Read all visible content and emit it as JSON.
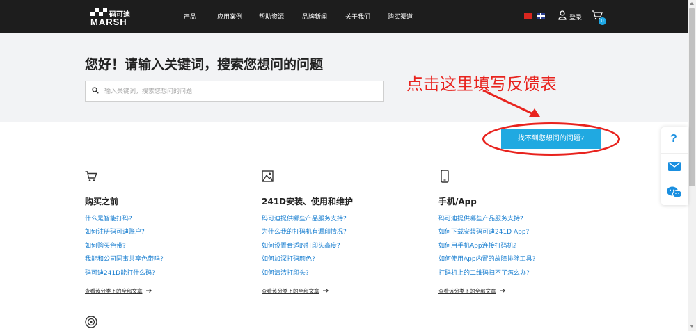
{
  "header": {
    "logo_cn": "码可迪",
    "logo_en": "MARSH",
    "nav": [
      "产品",
      "应用案例",
      "帮助资源",
      "品牌新闻",
      "关于我们",
      "购买渠道"
    ],
    "login_label": "登录",
    "cart_count": "0"
  },
  "hero": {
    "title": "您好！请输入关键词，搜索您想问的问题",
    "search_placeholder": "输入关键词，搜索您想问的问题"
  },
  "annotation": {
    "text": "点击这里填写反馈表",
    "color": "#e8231e"
  },
  "feedback_button": "找不到您想问的问题?",
  "categories": [
    {
      "icon": "shopping-cart-icon",
      "title": "购买之前",
      "links": [
        "什么是智能打码?",
        "如何注册码可迪账户?",
        "如何购买色带?",
        "我能和公司同事共享色带吗?",
        "码可迪241D能打什么码?"
      ],
      "more": "查看该分类下的全部文章"
    },
    {
      "icon": "image-frame-icon",
      "title": "241D安装、使用和维护",
      "links": [
        "码可迪提供哪些产品服务支持?",
        "为什么我的打码机有漏印情况?",
        "如何设置合适的打印头高度?",
        "如何加深打码颜色?",
        "如何清洁打印头?"
      ],
      "more": "查看该分类下的全部文章"
    },
    {
      "icon": "mobile-phone-icon",
      "title": "手机/App",
      "links": [
        "码可迪提供哪些产品服务支持?",
        "如何下载安装码可迪241D App?",
        "如何用手机App连接打码机?",
        "如何使用App内置的故障排除工具?",
        "打码机上的二维码扫不了怎么办?"
      ],
      "more": "查看该分类下的全部文章"
    }
  ],
  "colors": {
    "nav_bg": "#1d1d1d",
    "accent": "#20a9e1",
    "link": "#1a7fd0"
  }
}
